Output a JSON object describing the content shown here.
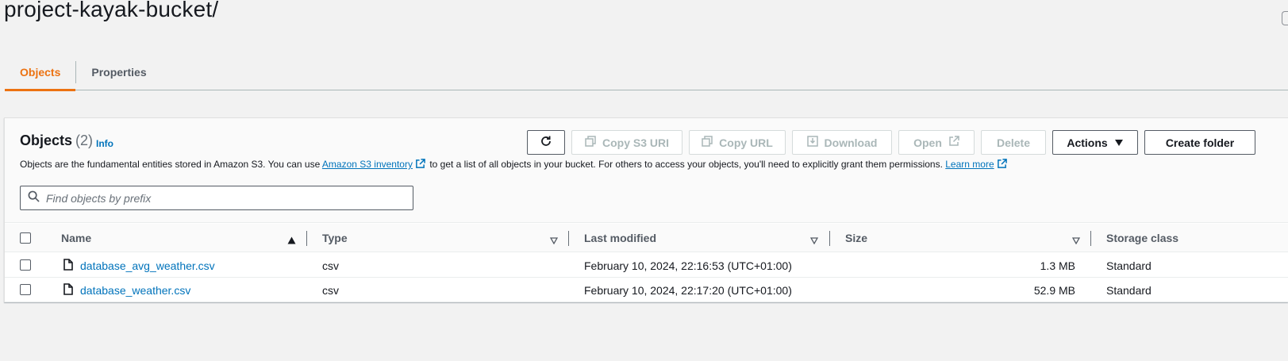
{
  "page": {
    "title": "project-kayak-bucket/"
  },
  "tabs": [
    {
      "label": "Objects",
      "active": true
    },
    {
      "label": "Properties",
      "active": false
    }
  ],
  "objects_panel": {
    "heading": "Objects",
    "count": "(2)",
    "info_label": "Info",
    "description": {
      "part1": "Objects are the fundamental entities stored in Amazon S3. You can use ",
      "inventory_link": "Amazon S3 inventory",
      "part2": " to get a list of all objects in your bucket. For others to access your objects, you'll need to explicitly grant them permissions. ",
      "learn_more": "Learn more"
    },
    "toolbar": {
      "copy_s3_uri": "Copy S3 URI",
      "copy_url": "Copy URL",
      "download": "Download",
      "open": "Open",
      "delete": "Delete",
      "actions": "Actions",
      "create_folder": "Create folder"
    },
    "search": {
      "placeholder": "Find objects by prefix",
      "value": ""
    }
  },
  "table": {
    "columns": [
      "Name",
      "Type",
      "Last modified",
      "Size",
      "Storage class"
    ],
    "rows": [
      {
        "name": "database_avg_weather.csv",
        "type": "csv",
        "last_modified": "February 10, 2024, 22:16:53 (UTC+01:00)",
        "size": "1.3 MB",
        "storage_class": "Standard"
      },
      {
        "name": "database_weather.csv",
        "type": "csv",
        "last_modified": "February 10, 2024, 22:17:20 (UTC+01:00)",
        "size": "52.9 MB",
        "storage_class": "Standard"
      }
    ]
  },
  "colors": {
    "accent": "#ec7211",
    "link": "#0073bb",
    "text": "#16191f",
    "muted": "#545b64"
  },
  "icons": [
    "refresh-icon",
    "copy-icon",
    "download-icon",
    "external-link-icon",
    "caret-down-icon",
    "search-icon",
    "file-icon",
    "sort-asc-icon",
    "sort-icon"
  ]
}
